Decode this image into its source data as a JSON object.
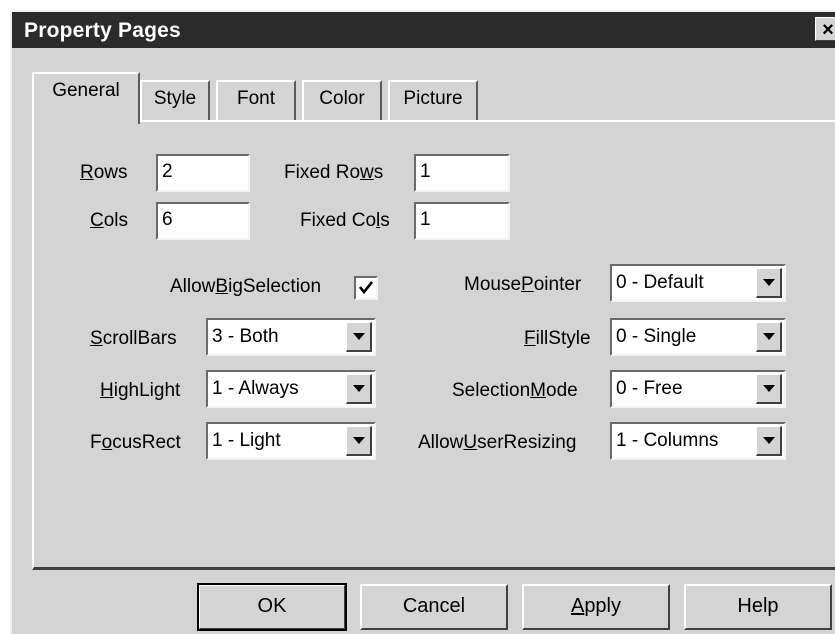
{
  "window": {
    "title": "Property Pages",
    "close_label": "×"
  },
  "tabs": [
    {
      "label": "General",
      "active": true
    },
    {
      "label": "Style"
    },
    {
      "label": "Font"
    },
    {
      "label": "Color"
    },
    {
      "label": "Picture"
    }
  ],
  "fields": {
    "rows": {
      "pre": "",
      "key": "R",
      "post": "ows",
      "value": "2"
    },
    "cols": {
      "pre": "",
      "key": "C",
      "post": "ols",
      "value": "6"
    },
    "fixed_rows": {
      "pre": "Fixed Ro",
      "key": "w",
      "post": "s",
      "value": "1"
    },
    "fixed_cols": {
      "pre": "Fixed Co",
      "key": "l",
      "post": "s",
      "value": "1"
    }
  },
  "allow_big_selection": {
    "pre": "Allow",
    "key": "B",
    "post": "igSelection",
    "checked": true
  },
  "combos": {
    "scrollbars": {
      "pre": "",
      "key": "S",
      "post": "crollBars",
      "value": "3 - Both"
    },
    "highlight": {
      "pre": "",
      "key": "H",
      "post": "ighLight",
      "value": "1 - Always"
    },
    "focusrect": {
      "pre": "F",
      "key": "o",
      "post": "cusRect",
      "value": "1 - Light"
    },
    "mousepointer": {
      "pre": "Mouse",
      "key": "P",
      "post": "ointer",
      "value": "0 - Default"
    },
    "fillstyle": {
      "pre": "",
      "key": "F",
      "post": "illStyle",
      "value": "0 - Single"
    },
    "selectionmode": {
      "pre": "Selection",
      "key": "M",
      "post": "ode",
      "value": "0 - Free"
    },
    "allowuserresizing": {
      "pre": "Allow",
      "key": "U",
      "post": "serResizing",
      "value": "1 - Columns"
    }
  },
  "buttons": {
    "ok": "OK",
    "cancel": "Cancel",
    "apply": {
      "pre": "",
      "key": "A",
      "post": "pply"
    },
    "help": "Help"
  }
}
